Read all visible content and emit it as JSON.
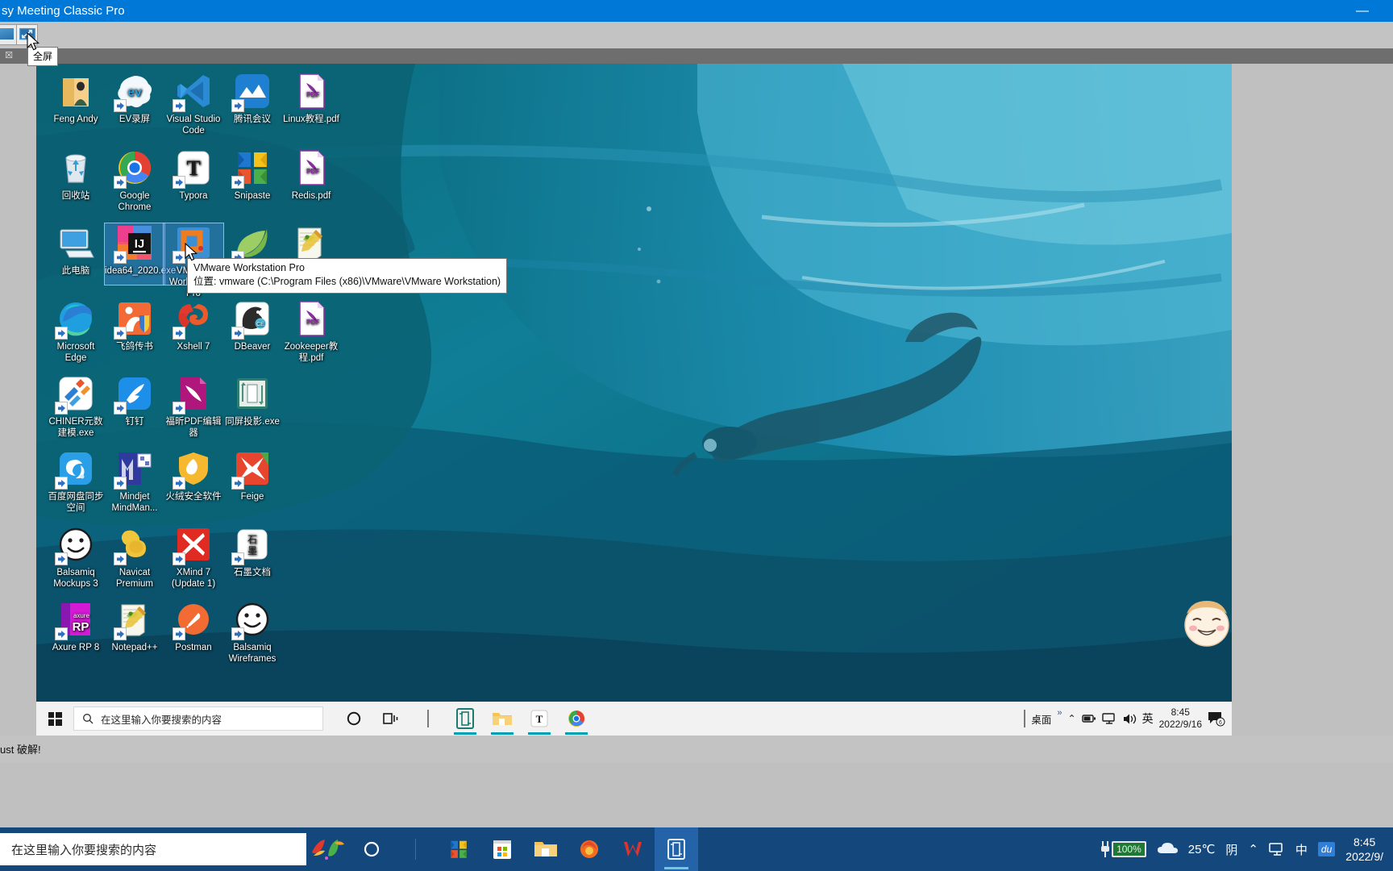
{
  "vmware_window": {
    "title": "sy Meeting Classic Pro",
    "minimize_label": "—",
    "toolbar": {
      "restore_button_name": "restore-window",
      "fullscreen_button_name": "enter-fullscreen"
    },
    "fullscreen_tooltip": "全屏",
    "tab_close_label": "☒"
  },
  "desktop": {
    "icons": [
      {
        "label": "Feng Andy",
        "icon": "folder-user-icon",
        "shortcut": false,
        "selected": false,
        "col": 0,
        "row": 0
      },
      {
        "label": "EV录屏",
        "icon": "ev-recorder-icon",
        "shortcut": true,
        "selected": false,
        "col": 1,
        "row": 0
      },
      {
        "label": "Visual Studio Code",
        "icon": "vscode-icon",
        "shortcut": true,
        "selected": false,
        "col": 2,
        "row": 0
      },
      {
        "label": "腾讯会议",
        "icon": "tencent-meeting-icon",
        "shortcut": true,
        "selected": false,
        "col": 3,
        "row": 0
      },
      {
        "label": "Linux教程.pdf",
        "icon": "pdf-icon",
        "shortcut": false,
        "selected": false,
        "col": 4,
        "row": 0
      },
      {
        "label": "回收站",
        "icon": "recycle-bin-icon",
        "shortcut": false,
        "selected": false,
        "col": 0,
        "row": 1
      },
      {
        "label": "Google Chrome",
        "icon": "chrome-icon",
        "shortcut": true,
        "selected": false,
        "col": 1,
        "row": 1
      },
      {
        "label": "Typora",
        "icon": "typora-icon",
        "shortcut": true,
        "selected": false,
        "col": 2,
        "row": 1
      },
      {
        "label": "Snipaste",
        "icon": "snipaste-icon",
        "shortcut": true,
        "selected": false,
        "col": 3,
        "row": 1
      },
      {
        "label": "Redis.pdf",
        "icon": "pdf-icon",
        "shortcut": false,
        "selected": false,
        "col": 4,
        "row": 1
      },
      {
        "label": "此电脑",
        "icon": "this-pc-icon",
        "shortcut": false,
        "selected": false,
        "col": 0,
        "row": 2
      },
      {
        "label": "idea64_2020.exe",
        "icon": "intellij-idea-icon",
        "shortcut": true,
        "selected": true,
        "col": 1,
        "row": 2
      },
      {
        "label": "VMware Workstation Pro",
        "icon": "vmware-icon",
        "shortcut": true,
        "selected": true,
        "col": 2,
        "row": 2
      },
      {
        "label": "",
        "icon": "spring-leaf-icon",
        "shortcut": true,
        "selected": false,
        "col": 3,
        "row": 2
      },
      {
        "label": "",
        "icon": "notepad-plus-icon",
        "shortcut": false,
        "selected": false,
        "col": 4,
        "row": 2
      },
      {
        "label": "Microsoft Edge",
        "icon": "edge-icon",
        "shortcut": true,
        "selected": false,
        "col": 0,
        "row": 3
      },
      {
        "label": "飞鸽传书",
        "icon": "feige-transfer-icon",
        "shortcut": true,
        "selected": false,
        "col": 1,
        "row": 3
      },
      {
        "label": "Xshell 7",
        "icon": "xshell-icon",
        "shortcut": true,
        "selected": false,
        "col": 2,
        "row": 3
      },
      {
        "label": "DBeaver",
        "icon": "dbeaver-icon",
        "shortcut": true,
        "selected": false,
        "col": 3,
        "row": 3
      },
      {
        "label": "Zookeeper教程.pdf",
        "icon": "pdf-icon",
        "shortcut": false,
        "selected": false,
        "col": 4,
        "row": 3
      },
      {
        "label": "CHINER元数建模.exe",
        "icon": "chiner-icon",
        "shortcut": true,
        "selected": false,
        "col": 0,
        "row": 4
      },
      {
        "label": "钉钉",
        "icon": "dingtalk-icon",
        "shortcut": true,
        "selected": false,
        "col": 1,
        "row": 4
      },
      {
        "label": "福昕PDF编辑器",
        "icon": "foxit-pdf-icon",
        "shortcut": true,
        "selected": false,
        "col": 2,
        "row": 4
      },
      {
        "label": "同屏投影.exe",
        "icon": "screen-mirror-icon",
        "shortcut": false,
        "selected": false,
        "col": 3,
        "row": 4
      },
      {
        "label": "百度网盘同步空间",
        "icon": "baidu-netdisk-icon",
        "shortcut": true,
        "selected": false,
        "col": 0,
        "row": 5
      },
      {
        "label": "Mindjet MindMan...",
        "icon": "mindmanager-icon",
        "shortcut": true,
        "selected": false,
        "col": 1,
        "row": 5
      },
      {
        "label": "火绒安全软件",
        "icon": "huorong-icon",
        "shortcut": true,
        "selected": false,
        "col": 2,
        "row": 5
      },
      {
        "label": "Feige",
        "icon": "feige-icon",
        "shortcut": true,
        "selected": false,
        "col": 3,
        "row": 5
      },
      {
        "label": "Balsamiq Mockups 3",
        "icon": "balsamiq-mockups-icon",
        "shortcut": true,
        "selected": false,
        "col": 0,
        "row": 6
      },
      {
        "label": "Navicat Premium",
        "icon": "navicat-icon",
        "shortcut": true,
        "selected": false,
        "col": 1,
        "row": 6
      },
      {
        "label": "XMind 7 (Update 1)",
        "icon": "xmind-icon",
        "shortcut": true,
        "selected": false,
        "col": 2,
        "row": 6
      },
      {
        "label": "石墨文档",
        "icon": "shimo-docs-icon",
        "shortcut": true,
        "selected": false,
        "col": 3,
        "row": 6
      },
      {
        "label": "Axure RP 8",
        "icon": "axure-icon",
        "shortcut": true,
        "selected": false,
        "col": 0,
        "row": 7
      },
      {
        "label": "Notepad++",
        "icon": "notepad-plus-icon",
        "shortcut": true,
        "selected": false,
        "col": 1,
        "row": 7
      },
      {
        "label": "Postman",
        "icon": "postman-icon",
        "shortcut": true,
        "selected": false,
        "col": 2,
        "row": 7
      },
      {
        "label": "Balsamiq Wireframes",
        "icon": "balsamiq-wireframes-icon",
        "shortcut": true,
        "selected": false,
        "col": 3,
        "row": 7
      }
    ],
    "tooltip": {
      "title": "VMware Workstation Pro",
      "location": "位置: vmware (C:\\Program Files (x86)\\VMware\\VMware Workstation)"
    }
  },
  "guest_taskbar": {
    "search_placeholder": "在这里输入你要搜索的内容",
    "buttons": [
      {
        "name": "cortana-icon",
        "label": "○"
      },
      {
        "name": "task-view-icon",
        "label": "☰"
      }
    ],
    "pinned": [
      {
        "name": "taskbar-screen-mirror-icon",
        "active": true
      },
      {
        "name": "taskbar-file-explorer-icon",
        "active": true
      },
      {
        "name": "taskbar-typora-icon",
        "active": true
      },
      {
        "name": "taskbar-chrome-icon",
        "active": true
      }
    ],
    "tray": {
      "desktop_label": "桌面",
      "overflow": "»",
      "chevron": "⌃",
      "ime": "英",
      "time": "8:45",
      "date": "2022/9/16",
      "notification_count": "6"
    }
  },
  "host_strip": {
    "text": "ust 破解!"
  },
  "host_taskbar": {
    "search_placeholder": "在这里输入你要搜索的内容",
    "buttons": [
      {
        "name": "host-cortana-icon"
      }
    ],
    "pinned": [
      {
        "name": "host-snipaste-icon",
        "active": false
      },
      {
        "name": "host-microsoft-store-icon",
        "active": false
      },
      {
        "name": "host-file-explorer-icon",
        "active": false
      },
      {
        "name": "host-firefox-icon",
        "active": false
      },
      {
        "name": "host-wps-icon",
        "active": false
      },
      {
        "name": "host-vmware-icon",
        "active": true
      }
    ],
    "tray": {
      "battery_percent": "100%",
      "temperature": "25℃",
      "weather": "阴",
      "chevron": "⌃",
      "ime": "中",
      "baidu_label": "du",
      "time": "8:45",
      "date": "2022/9/"
    }
  },
  "colors": {
    "vmware_title_bar": "#0078d7",
    "window_chrome": "#c3c3c3",
    "tab_strip": "#6e6e6e",
    "host_taskbar": "#14487c",
    "guest_taskbar": "#f2f2f2",
    "accent_teal": "#00a0b4",
    "selection": "#4a8cdc"
  }
}
